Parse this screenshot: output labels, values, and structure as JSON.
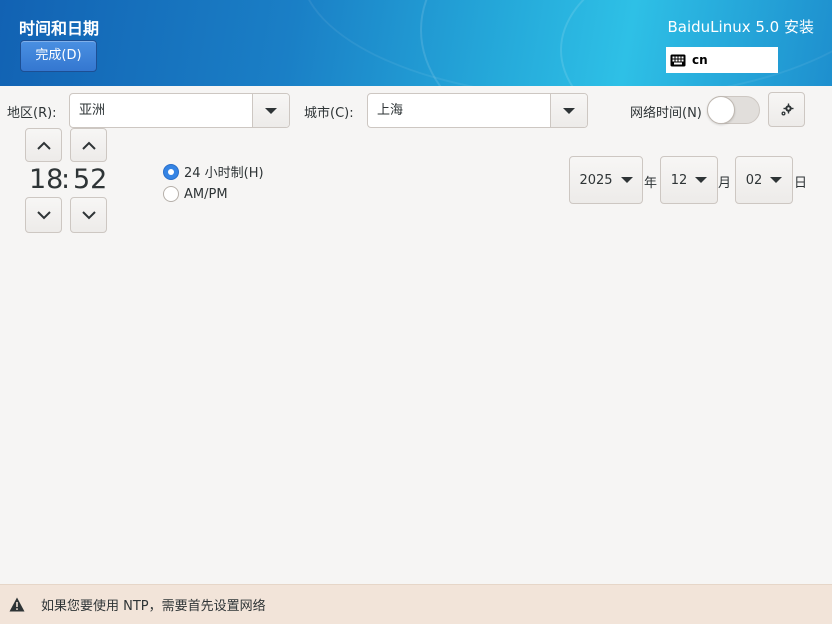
{
  "header": {
    "title": "时间和日期",
    "done_label": "完成(D)",
    "product": "BaiduLinux 5.0 安装",
    "keyboard_layout": "cn"
  },
  "location": {
    "region_label": "地区(R):",
    "region_value": "亚洲",
    "city_label": "城市(C):",
    "city_value": "上海",
    "network_time_label": "网络时间(N)",
    "network_time_on": false
  },
  "time": {
    "hours": "18",
    "separator": ":",
    "minutes": "52",
    "format_24h_label": "24 小时制(H)",
    "format_ampm_label": "AM/PM",
    "selected_format": "24h"
  },
  "date": {
    "year": "2025",
    "year_suffix": "年",
    "month": "12",
    "month_suffix": "月",
    "day": "02",
    "day_suffix": "日"
  },
  "footer": {
    "warning": "如果您要使用 NTP，需要首先设置网络"
  },
  "icons": [
    "keyboard-icon",
    "chevron-up-icon",
    "chevron-down-icon",
    "gear-icon",
    "warning-icon",
    "dropdown-arrow-icon"
  ]
}
